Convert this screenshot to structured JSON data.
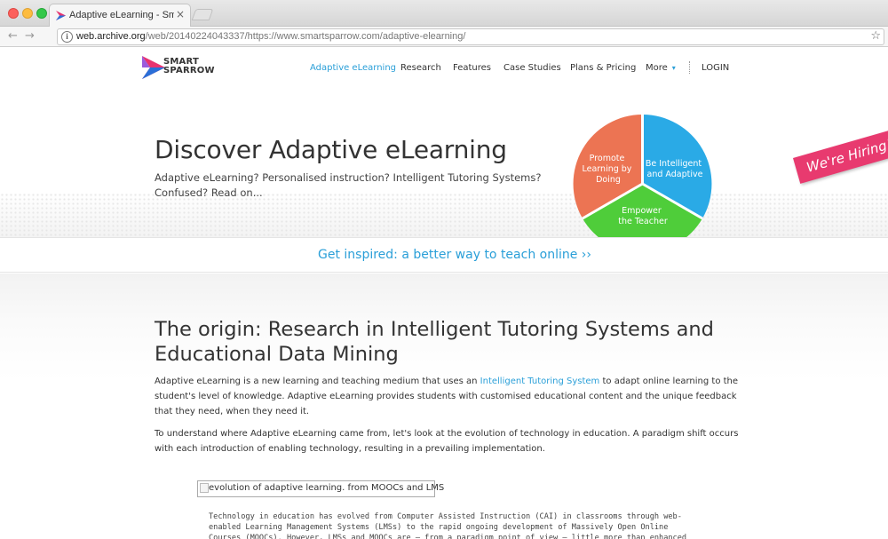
{
  "browser": {
    "tab_title": "Adaptive eLearning - Smart Sp",
    "tab_close": "×",
    "url_host": "web.archive.org",
    "url_path": "/web/20140224043337/https://www.smartsparrow.com/adaptive-elearning/",
    "back_glyph": "←",
    "forward_glyph": "→",
    "reload_glyph": "C",
    "info_glyph": "i",
    "star_glyph": "☆"
  },
  "logo": {
    "line1": "SMART",
    "line2": "SPARROW"
  },
  "nav": {
    "items": [
      {
        "label": "Adaptive eLearning",
        "active": true
      },
      {
        "label": "Research"
      },
      {
        "label": "Features"
      },
      {
        "label": "Case Studies"
      },
      {
        "label": "Plans & Pricing"
      },
      {
        "label": "More"
      }
    ],
    "more_caret": "▾",
    "login": "LOGIN"
  },
  "hero": {
    "title": "Discover Adaptive eLearning",
    "subtitle": "Adaptive eLearning? Personalised instruction? Intelligent Tutoring Systems? Confused? Read on...",
    "pie": {
      "segments": [
        {
          "lines": [
            "Be Intelligent",
            "and Adaptive"
          ],
          "color": "#2aaae6"
        },
        {
          "lines": [
            "Empower",
            "the Teacher"
          ],
          "color": "#4fcd3a"
        },
        {
          "lines": [
            "Promote",
            "Learning by",
            "Doing"
          ],
          "color": "#ec7453"
        }
      ]
    },
    "hiring_banner": "We're Hiring!"
  },
  "inspired_link": "Get inspired: a better way to teach online ››",
  "content": {
    "heading": "The origin: Research in Intelligent Tutoring Systems and Educational Data Mining",
    "p1_before": "Adaptive eLearning is a new learning and teaching medium that uses an ",
    "p1_link": "Intelligent Tutoring System",
    "p1_after": " to adapt online learning to the student's level of knowledge. Adaptive eLearning provides students with customised educational content and the unique feedback that they need, when they need it.",
    "p2": "To understand where Adaptive eLearning came from, let's look at the evolution of technology in education. A paradigm shift occurs with each introduction of enabling technology, resulting in a prevailing implementation.",
    "image_alt": "evolution of adaptive learning. from MOOCs and LMS",
    "p3": "Technology in education has evolved from Computer Assisted Instruction (CAI) in classrooms through web-enabled Learning Management Systems (LMSs) to the rapid ongoing development of Massively Open Online Courses (MOOCs). However, LMSs and MOOCs are — from a paradigm point of view — little more than enhanced delivery systems for traditional content. The"
  },
  "colors": {
    "accent": "#2a9fd8",
    "hiring": "#e83a6f",
    "logo_pink": "#e8336f",
    "logo_blue": "#2a6fd8"
  }
}
